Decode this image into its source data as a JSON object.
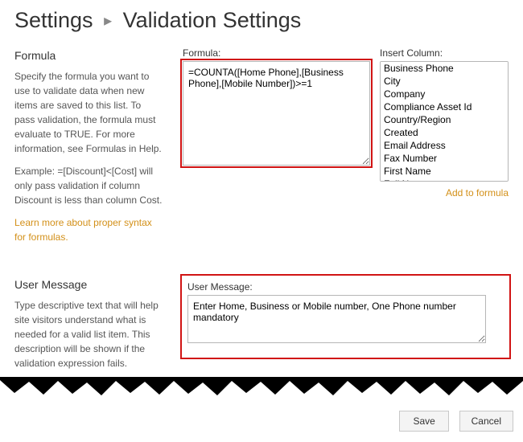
{
  "breadcrumb": {
    "parent": "Settings",
    "current": "Validation Settings"
  },
  "formula_section": {
    "heading": "Formula",
    "desc1": "Specify the formula you want to use to validate data when new items are saved to this list. To pass validation, the formula must evaluate to TRUE. For more information, see Formulas in Help.",
    "desc2": "Example: =[Discount]<[Cost] will only pass validation if column Discount is less than column Cost.",
    "learn_link": "Learn more about proper syntax for formulas.",
    "formula_label": "Formula:",
    "formula_value": "=COUNTA([Home Phone],[Business Phone],[Mobile Number])>=1",
    "insert_label": "Insert Column:",
    "columns": [
      "Business Phone",
      "City",
      "Company",
      "Compliance Asset Id",
      "Country/Region",
      "Created",
      "Email Address",
      "Fax Number",
      "First Name",
      "Full Name"
    ],
    "add_link": "Add to formula"
  },
  "usermsg_section": {
    "heading": "User Message",
    "desc": "Type descriptive text that will help site visitors understand what is needed for a valid list item. This description will be shown if the validation expression fails.",
    "label": "User Message:",
    "value": "Enter Home, Business or Mobile number, One Phone number mandatory"
  },
  "buttons": {
    "save": "Save",
    "cancel": "Cancel"
  }
}
